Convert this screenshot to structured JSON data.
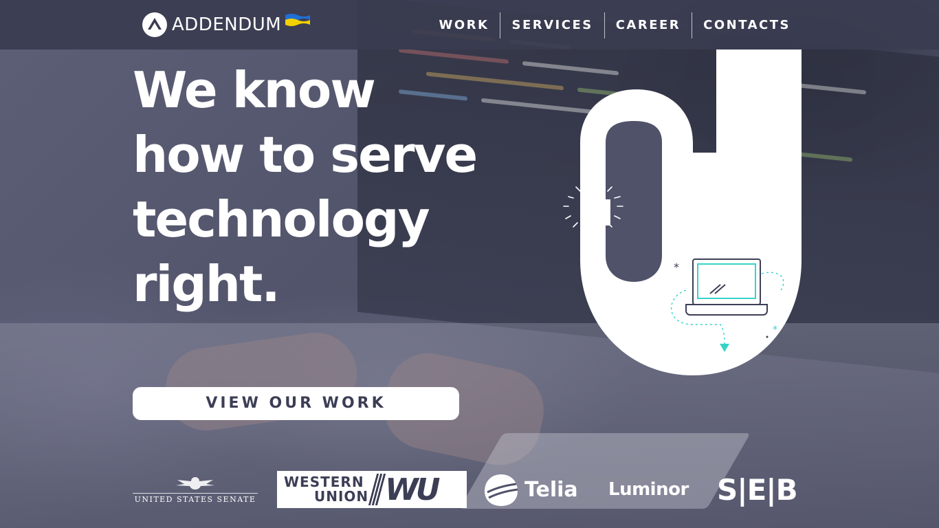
{
  "brand": {
    "name": "ADDENDUM",
    "flag_colors": [
      "#1f6fd6",
      "#f5d000"
    ]
  },
  "nav": {
    "items": [
      {
        "label": "WORK"
      },
      {
        "label": "SERVICES"
      },
      {
        "label": "CAREER"
      },
      {
        "label": "CONTACTS"
      }
    ]
  },
  "hero": {
    "title_lines": [
      "We know",
      "how to serve",
      "technology",
      "right."
    ],
    "cta_label": "VIEW OUR WORK"
  },
  "illustration": {
    "icon": "ok-hand-gesture-icon",
    "accent_color": "#37d3c9"
  },
  "partners": {
    "senate": "UNITED STATES SENATE",
    "western_union_line1": "WESTERN",
    "western_union_line2": "UNION",
    "western_union_mark": "WU",
    "telia": "Telia",
    "luminor": "Luminor",
    "seb": "S|E|B"
  },
  "colors": {
    "header_bg": "#3a3c50",
    "button_text": "#3c3e55",
    "accent": "#37d3c9"
  }
}
